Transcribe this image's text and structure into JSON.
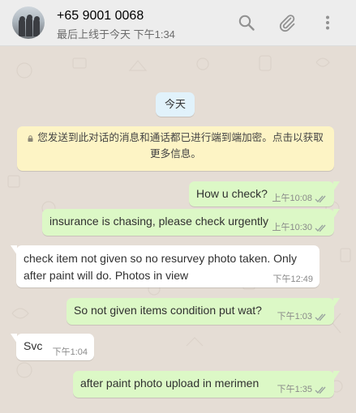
{
  "contact": {
    "name": "+65 9001 0068",
    "last_seen": "最后上线于今天 下午1:34"
  },
  "header_icons": [
    "search-icon",
    "attach-icon",
    "menu-icon"
  ],
  "chat": {
    "date_label": "今天",
    "encryption_notice": "您发送到此对话的消息和通话都已进行端到端加密。点击以获取更多信息。",
    "messages": [
      {
        "direction": "out",
        "text": "How u check?",
        "time": "上午10:08",
        "status": "read"
      },
      {
        "direction": "out",
        "text": "insurance is chasing, please check urgently",
        "time": "上午10:30",
        "status": "read"
      },
      {
        "direction": "in",
        "text_line1": "check item not given so no resurvey photo taken. Only",
        "text_line2": "after paint will do. Photos in view",
        "time": "下午12:49"
      },
      {
        "direction": "out",
        "text": "So not given items condition put wat?",
        "time": "下午1:03",
        "status": "read"
      },
      {
        "direction": "in",
        "text": "Svc",
        "time": "下午1:04"
      },
      {
        "direction": "out",
        "text": "after paint photo upload in merimen",
        "time": "下午1:35",
        "status": "read"
      }
    ]
  },
  "colors": {
    "header_bg": "#ededed",
    "chat_bg": "#e5ddd5",
    "outgoing_bubble": "#dcf8c6",
    "incoming_bubble": "#ffffff",
    "notice_bg": "#fdf4c5",
    "date_chip_bg": "#e1f2fb",
    "read_tick": "#4fc3f7"
  }
}
